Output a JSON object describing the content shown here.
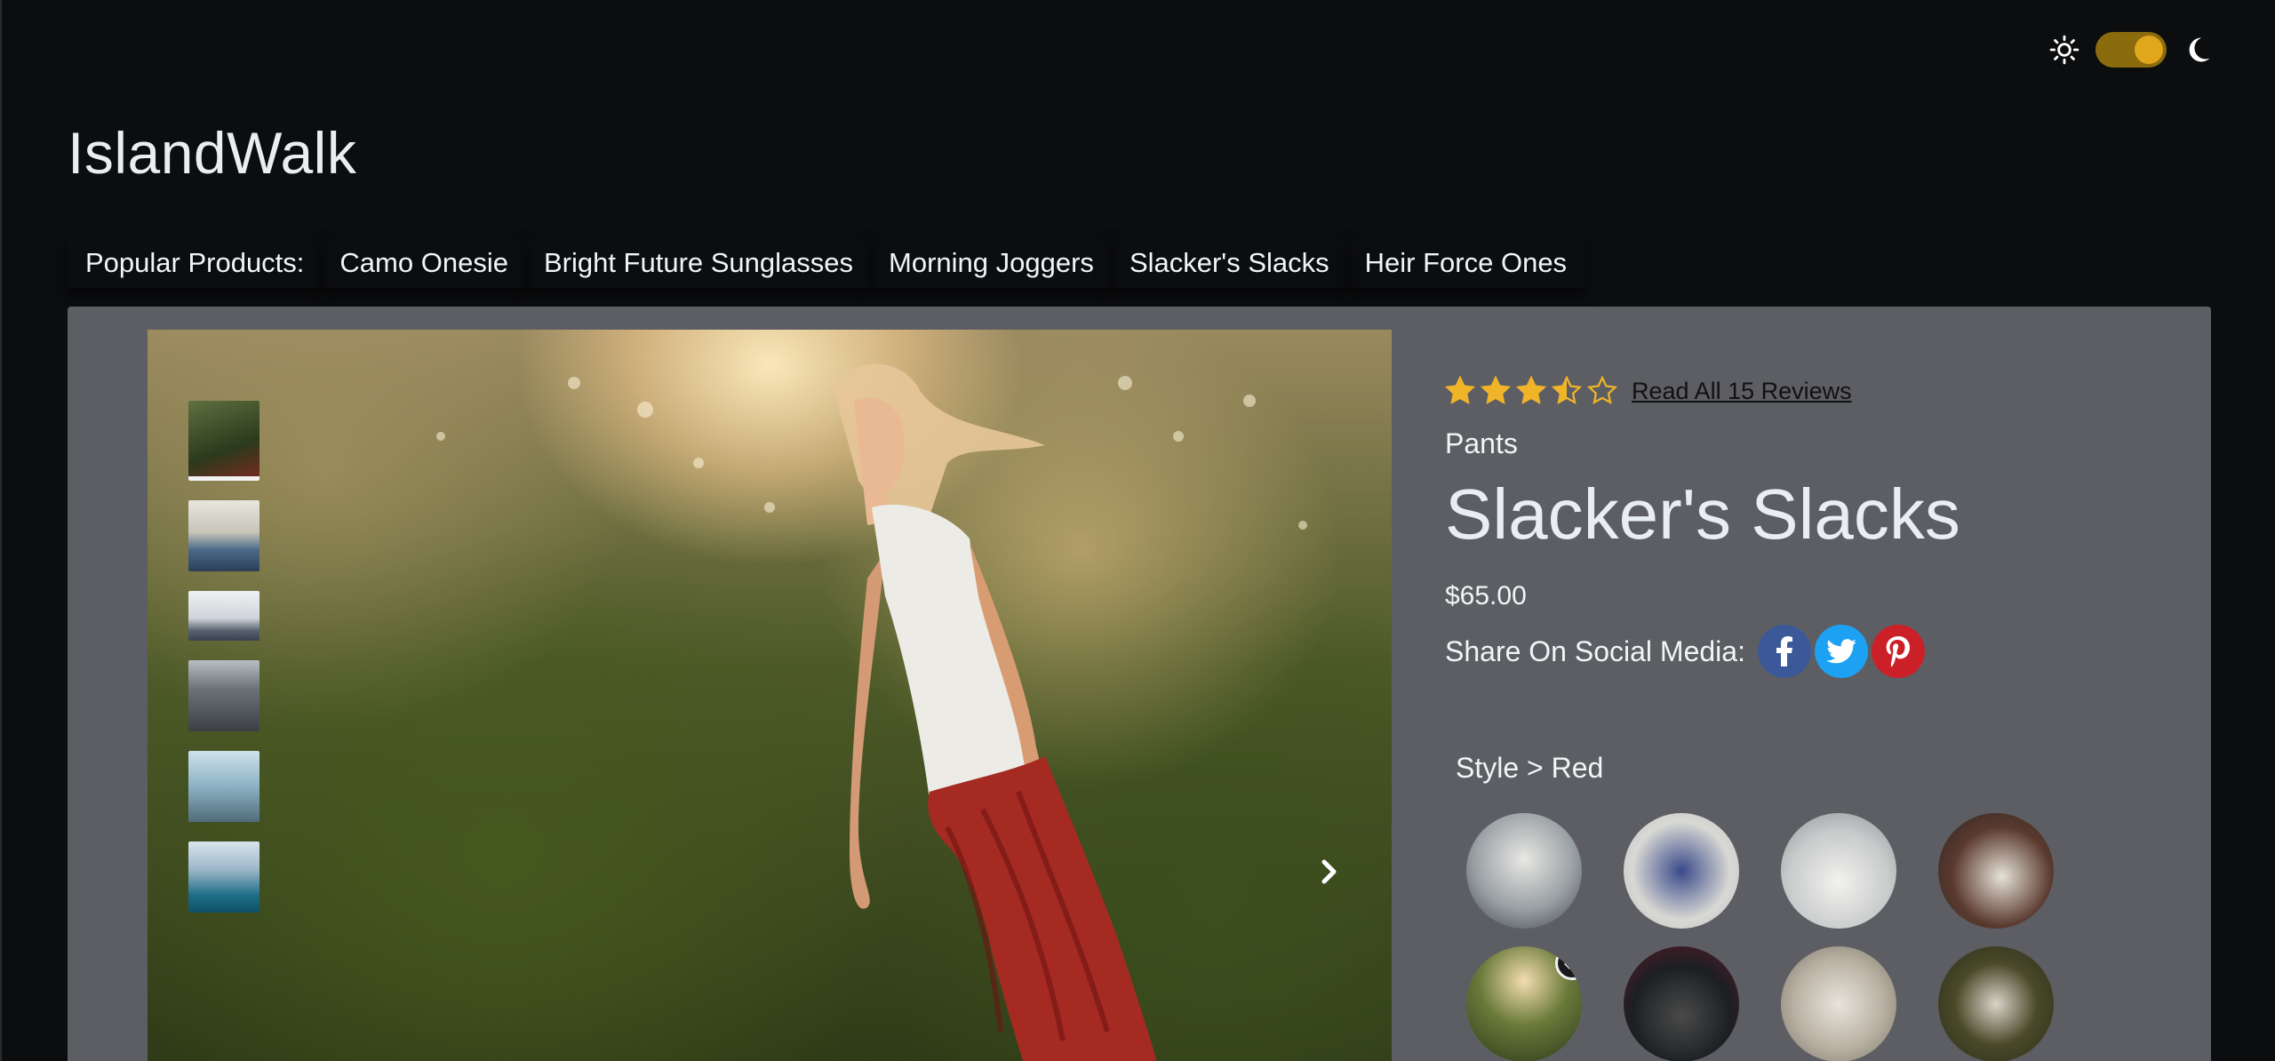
{
  "theme_toggle": {
    "left_icon": "sun-icon",
    "right_icon": "moon-icon",
    "state": "dark",
    "track_color": "#8a6b0d",
    "knob_color": "#e0a61c"
  },
  "brand": {
    "name": "IslandWalk"
  },
  "popular_products": {
    "label": "Popular Products:",
    "items": [
      "Camo Onesie",
      "Bright Future Sunglasses",
      "Morning Joggers",
      "Slacker's Slacks",
      "Heir Force Ones"
    ]
  },
  "gallery": {
    "thumbnail_count": 6,
    "selected_index": 0,
    "next_icon": "chevron-right-icon"
  },
  "product": {
    "rating": 3.5,
    "rating_max": 5,
    "reviews_link": "Read All 15 Reviews",
    "category": "Pants",
    "name": "Slacker's Slacks",
    "price": "$65.00",
    "share_label": "Share On Social Media:",
    "social": [
      "facebook-icon",
      "twitter-icon",
      "pinterest-icon"
    ],
    "style_label": "Style > Red",
    "style_count": 8,
    "selected_style_index": 4
  },
  "colors": {
    "page_bg": "#0c0d0f",
    "panel_bg": "#5d5e63",
    "star": "#f0b429",
    "facebook": "#3b5998",
    "twitter": "#1da1f2",
    "pinterest": "#cb2027"
  }
}
